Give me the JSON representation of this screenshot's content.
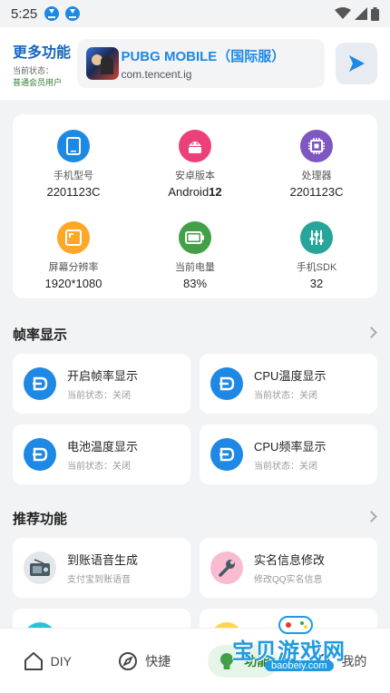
{
  "status_bar": {
    "time": "5:25"
  },
  "header": {
    "title": "更多功能",
    "status_label": "当前状态：",
    "status_value": "普通会员用户",
    "app_name": "PUBG MOBILE（国际服）",
    "app_package": "com.tencent.ig"
  },
  "device_info": [
    {
      "label": "手机型号",
      "value": "2201123C",
      "icon": "phone-icon",
      "color": "#1e88e5"
    },
    {
      "label": "安卓版本",
      "value_prefix": "Android",
      "value_bold": "12",
      "icon": "android-icon",
      "color": "#ec407a"
    },
    {
      "label": "处理器",
      "value": "2201123C",
      "icon": "chip-icon",
      "color": "#7e57c2"
    },
    {
      "label": "屏幕分辨率",
      "value": "1920*1080",
      "icon": "screen-icon",
      "color": "#ffa726"
    },
    {
      "label": "当前电量",
      "value": "83%",
      "icon": "battery-icon",
      "color": "#43a047"
    },
    {
      "label": "手机SDK",
      "value": "32",
      "icon": "sliders-icon",
      "color": "#26a69a"
    }
  ],
  "frame_section": {
    "title": "帧率显示",
    "items": [
      {
        "title": "开启帧率显示",
        "status": "当前状态：关闭"
      },
      {
        "title": "CPU温度显示",
        "status": "当前状态：关闭"
      },
      {
        "title": "电池温度显示",
        "status": "当前状态：关闭"
      },
      {
        "title": "CPU频率显示",
        "status": "当前状态：关闭"
      }
    ]
  },
  "recommend_section": {
    "title": "推荐功能",
    "items": [
      {
        "title": "到账语音生成",
        "sub": "支付宝到账语音"
      },
      {
        "title": "实名信息修改",
        "sub": "修改QQ实名信息"
      }
    ]
  },
  "bottom_nav": [
    {
      "label": "DIY"
    },
    {
      "label": "快捷"
    },
    {
      "label": "功能"
    },
    {
      "label": "我的"
    }
  ],
  "watermark": {
    "title": "宝贝游戏网",
    "url": "baobeiy.com"
  },
  "colors": {
    "accent": "#1e88e5",
    "active_nav": "#2e7d32"
  }
}
